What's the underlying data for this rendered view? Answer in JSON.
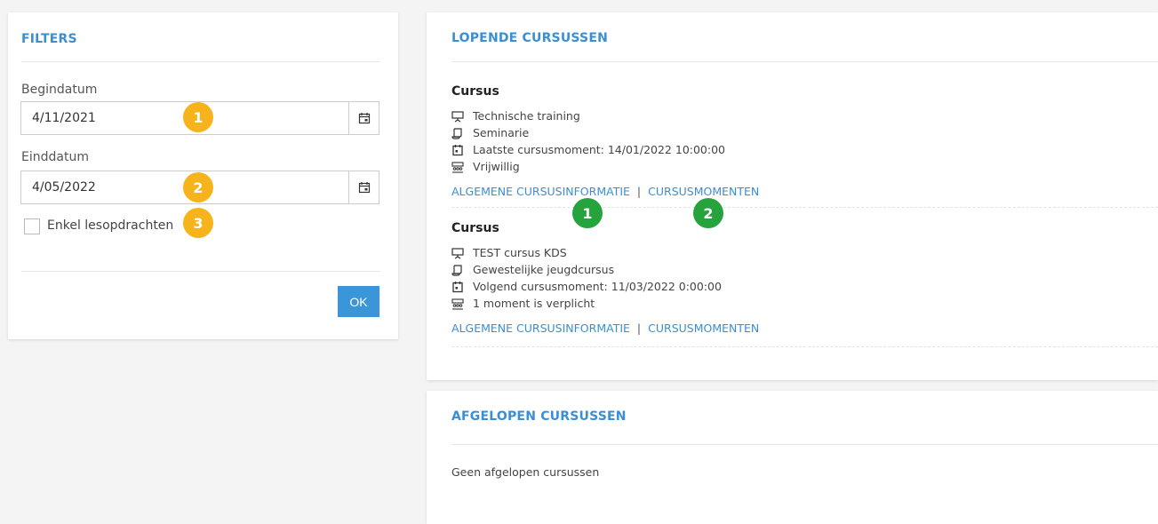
{
  "filters": {
    "title": "FILTERS",
    "begin_label": "Begindatum",
    "begin_value": "4/11/2021",
    "end_label": "Einddatum",
    "end_value": "4/05/2022",
    "checkbox_label": "Enkel lesopdrachten",
    "ok_label": "OK"
  },
  "badges": {
    "yellow1": "1",
    "yellow2": "2",
    "yellow3": "3",
    "green1": "1",
    "green2": "2"
  },
  "lopende": {
    "title": "LOPENDE CURSUSSEN",
    "courses": [
      {
        "heading": "Cursus",
        "name": "Technische training",
        "type": "Seminarie",
        "moment": "Laatste cursusmoment: 14/01/2022 10:00:00",
        "attendance": "Vrijwillig",
        "link_info": "ALGEMENE CURSUSINFORMATIE",
        "link_sep": "|",
        "link_moments": "CURSUSMOMENTEN"
      },
      {
        "heading": "Cursus",
        "name": "TEST cursus KDS",
        "type": "Gewestelijke jeugdcursus",
        "moment": "Volgend cursusmoment: 11/03/2022 0:00:00",
        "attendance": "1 moment is verplicht",
        "link_info": "ALGEMENE CURSUSINFORMATIE",
        "link_sep": "|",
        "link_moments": "CURSUSMOMENTEN"
      }
    ]
  },
  "afgelopen": {
    "title": "AFGELOPEN CURSUSSEN",
    "empty": "Geen afgelopen cursussen"
  },
  "colors": {
    "accent": "#3a8fd4",
    "badge_yellow": "#f7b31b",
    "badge_green": "#27a33d",
    "ok_button": "#3a96d8"
  }
}
